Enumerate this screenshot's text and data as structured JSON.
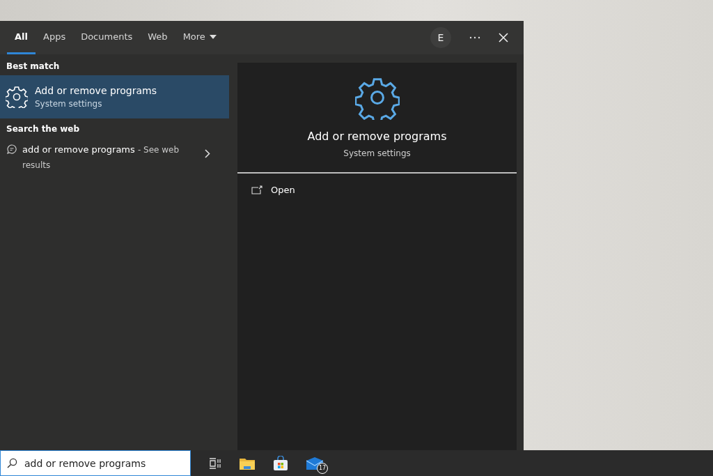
{
  "tabs": [
    {
      "label": "All",
      "selected": true,
      "kind": "tab"
    },
    {
      "label": "Apps",
      "selected": false,
      "kind": "tab"
    },
    {
      "label": "Documents",
      "selected": false,
      "kind": "tab"
    },
    {
      "label": "Web",
      "selected": false,
      "kind": "tab"
    },
    {
      "label": "More",
      "selected": false,
      "kind": "menu"
    }
  ],
  "account": {
    "initial": "E"
  },
  "best_match": {
    "heading": "Best match",
    "title": "Add or remove programs",
    "subtitle": "System settings",
    "selected": true
  },
  "web_search": {
    "heading": "Search the web",
    "query": "add or remove programs",
    "suffix": "- See web results"
  },
  "preview": {
    "title": "Add or remove programs",
    "subtitle": "System settings",
    "actions": [
      {
        "label": "Open"
      }
    ]
  },
  "taskbar": {
    "search": {
      "value": "add or remove programs"
    },
    "mail_badge": "17"
  }
}
